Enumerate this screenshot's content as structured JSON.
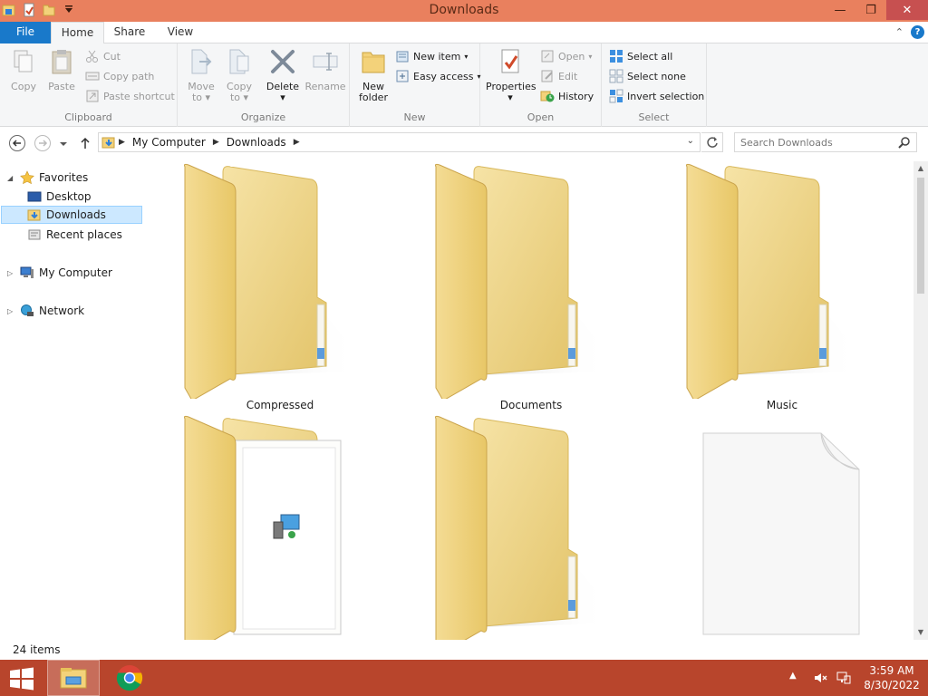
{
  "window": {
    "title": "Downloads"
  },
  "ribbon": {
    "tabs": [
      {
        "label": "File"
      },
      {
        "label": "Home"
      },
      {
        "label": "Share"
      },
      {
        "label": "View"
      }
    ],
    "clipboard": {
      "label": "Clipboard",
      "copy": "Copy",
      "paste": "Paste",
      "cut": "Cut",
      "copy_path": "Copy path",
      "paste_shortcut": "Paste shortcut"
    },
    "organize": {
      "label": "Organize",
      "move_to": "Move",
      "move_to_2": "to",
      "copy_to": "Copy",
      "copy_to_2": "to",
      "delete": "Delete",
      "rename": "Rename"
    },
    "new": {
      "label": "New",
      "new_folder": "New",
      "new_folder_2": "folder",
      "new_item": "New item",
      "easy_access": "Easy access"
    },
    "open": {
      "label": "Open",
      "properties": "Properties",
      "open": "Open",
      "edit": "Edit",
      "history": "History"
    },
    "select": {
      "label": "Select",
      "select_all": "Select all",
      "select_none": "Select none",
      "invert_selection": "Invert selection"
    }
  },
  "address": {
    "crumbs": [
      "My Computer",
      "Downloads"
    ],
    "search_placeholder": "Search Downloads"
  },
  "navpane": {
    "favorites": "Favorites",
    "desktop": "Desktop",
    "downloads": "Downloads",
    "recent_places": "Recent places",
    "my_computer": "My Computer",
    "network": "Network"
  },
  "items": [
    {
      "name": "Compressed",
      "kind": "folder"
    },
    {
      "name": "Documents",
      "kind": "folder"
    },
    {
      "name": "Music",
      "kind": "folder"
    },
    {
      "name": "",
      "kind": "folder-installer"
    },
    {
      "name": "",
      "kind": "folder"
    },
    {
      "name": "",
      "kind": "file"
    }
  ],
  "status": {
    "count": "24 items"
  },
  "taskbar": {
    "time": "3:59 AM",
    "date": "8/30/2022"
  },
  "colors": {
    "titlebar": "#e9805e",
    "taskbar": "#b8452c",
    "accent": "#1979ca",
    "selection": "#cce8ff"
  }
}
